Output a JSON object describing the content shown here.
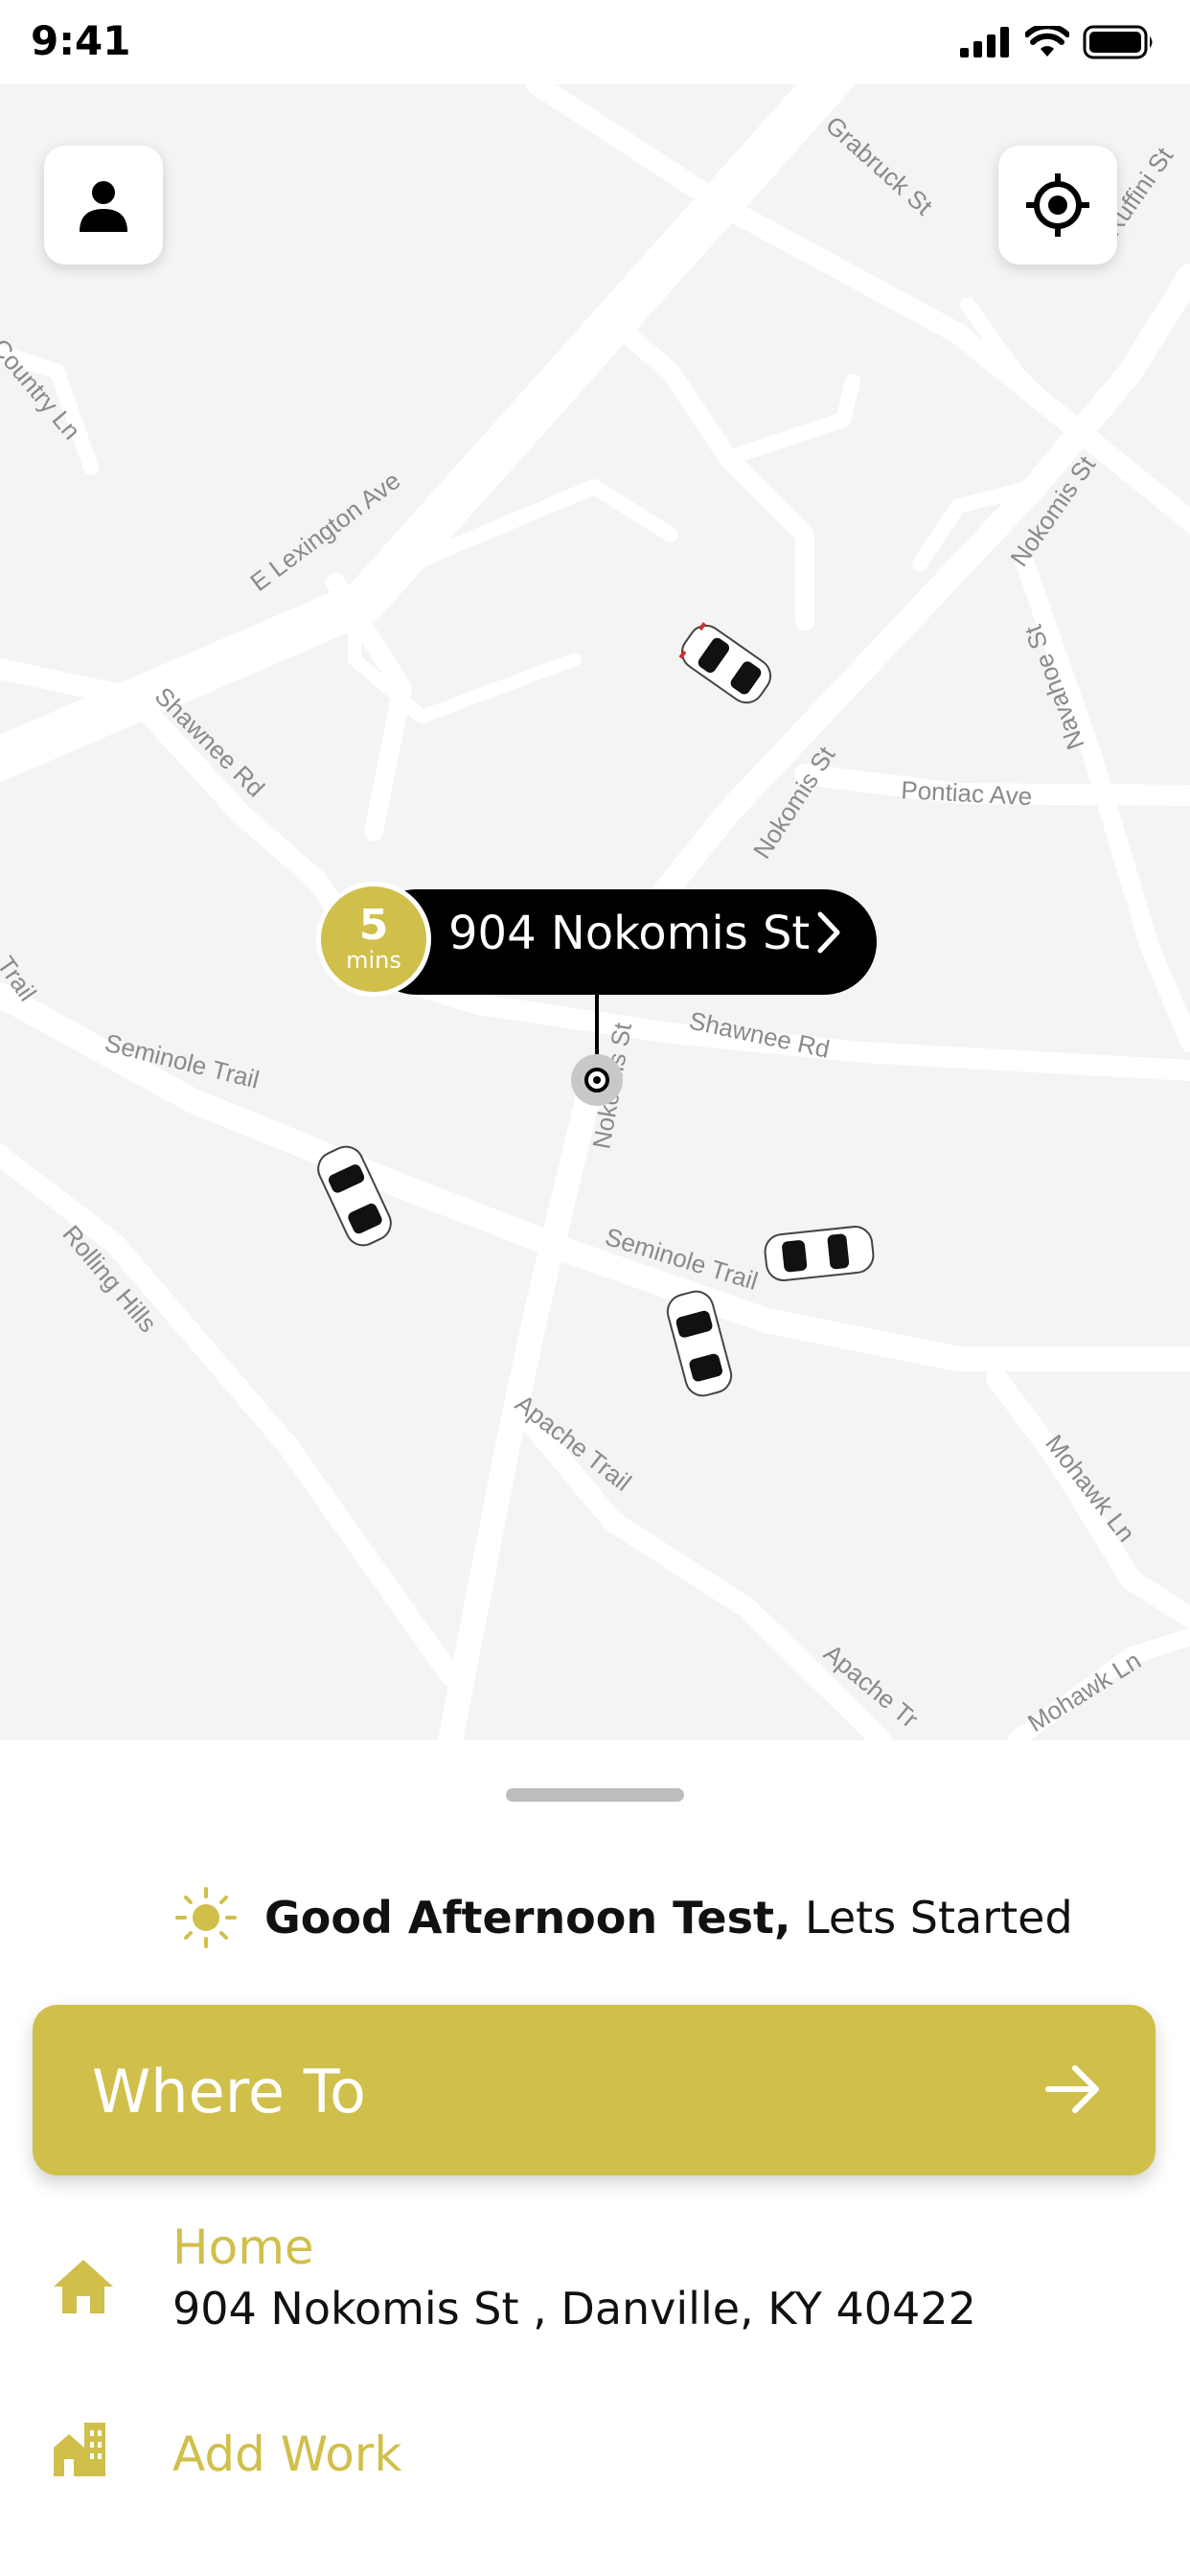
{
  "status_bar": {
    "time": "9:41"
  },
  "map": {
    "street_labels": [
      "E Lexington Ave",
      "Grabruck St",
      "Ruffini St",
      "Country Ln",
      "Shawnee Rd",
      "Nokomis St",
      "Pontiac Ave",
      "Navahoe St",
      "Trail",
      "Seminole Trail",
      "Rolling Hills",
      "Apache Trail",
      "Mohawk Ln",
      "Apache Tr",
      "Mohawk Ln"
    ],
    "pickup": {
      "eta_value": "5",
      "eta_unit": "mins",
      "address": "904 Nokomis St"
    }
  },
  "icons": {
    "profile": "person-icon",
    "locate": "crosshair-icon",
    "greeting": "sun-icon",
    "where_to": "arrow-right-icon",
    "home": "home-icon",
    "work": "building-icon"
  },
  "sheet": {
    "greeting_bold": "Good Afternoon Test,",
    "greeting_rest": " Lets Started",
    "where_to_label": "Where To",
    "saved_places": [
      {
        "title": "Home",
        "address": "904 Nokomis St , Danville, KY 40422"
      },
      {
        "title": "Add Work"
      }
    ]
  },
  "colors": {
    "accent": "#d0bf4b",
    "map_bg": "#f4f4f4",
    "road": "#ffffff",
    "pill": "#000000"
  }
}
